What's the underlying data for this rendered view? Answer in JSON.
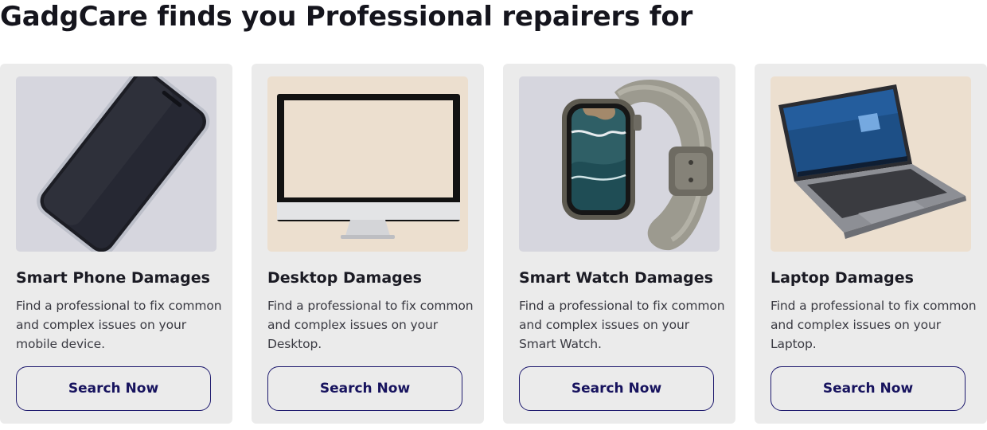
{
  "heading": "GadgCare finds you Professional repairers for",
  "cards": [
    {
      "title": "Smart Phone Damages",
      "description": "Find a professional to fix common and complex issues on your mobile device.",
      "button_label": "Search Now",
      "image_background": "#d6d6de"
    },
    {
      "title": "Desktop Damages",
      "description": "Find a professional to fix common and complex issues on your Desktop.",
      "button_label": "Search Now",
      "image_background": "#ecdfcf"
    },
    {
      "title": "Smart Watch Damages",
      "description": "Find a professional to fix common and complex issues on your Smart Watch.",
      "button_label": "Search Now",
      "image_background": "#d6d6de"
    },
    {
      "title": "Laptop Damages",
      "description": "Find a professional to fix common and complex issues on your Laptop.",
      "button_label": "Search Now",
      "image_background": "#ecdfcf"
    }
  ],
  "colors": {
    "card_background": "#ebebeb",
    "button_border": "#1e1a6e",
    "button_text": "#17135e"
  }
}
